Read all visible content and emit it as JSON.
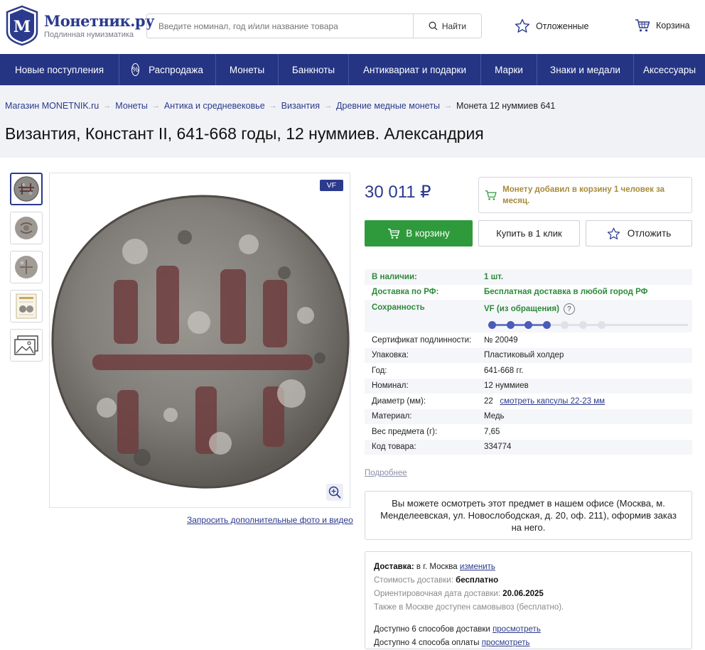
{
  "header": {
    "logo_title": "Монетник.ру",
    "logo_subtitle": "Подлинная нумизматика",
    "search_placeholder": "Введите номинал, год и/или название товара",
    "search_button": "Найти",
    "saved_label": "Отложенные",
    "cart_label": "Корзина"
  },
  "nav": {
    "items": [
      "Новые поступления",
      "Распродажа",
      "Монеты",
      "Банкноты",
      "Антиквариат и подарки",
      "Марки",
      "Знаки и медали",
      "Аксессуары"
    ],
    "sale_badge": "%"
  },
  "breadcrumb": {
    "items": [
      "Магазин MONETNIK.ru",
      "Монеты",
      "Антика и средневековье",
      "Византия",
      "Древние медные монеты"
    ],
    "current": "Монета 12 нуммиев 641",
    "separator": "→"
  },
  "product": {
    "title": "Византия, Констант II, 641-668 годы, 12 нуммиев. Александрия",
    "grade_badge": "VF",
    "price": "30 011 ₽",
    "cart_notice": "Монету добавил в корзину 1 человек за месяц.",
    "request_link": "Запросить дополнительные фото и видео",
    "buttons": {
      "add_to_cart": "В корзину",
      "buy_one_click": "Купить в 1 клик",
      "defer": "Отложить"
    },
    "availability": {
      "label": "В наличии:",
      "value": "1 шт."
    },
    "shipping": {
      "label": "Доставка по РФ:",
      "value": "Бесплатная доставка в любой город РФ"
    },
    "condition": {
      "label": "Сохранность",
      "value": "VF (из обращения)",
      "help": "?",
      "level": 4,
      "max": 7
    },
    "specs": [
      {
        "k": "Сертификат подлинности:",
        "v": "№ 20049"
      },
      {
        "k": "Упаковка:",
        "v": "Пластиковый холдер"
      },
      {
        "k": "Год:",
        "v": "641-668 гг."
      },
      {
        "k": "Номинал:",
        "v": "12 нуммиев"
      },
      {
        "k": "Диаметр (мм):",
        "v": "22",
        "link": "смотреть капсулы 22-23 мм"
      },
      {
        "k": "Материал:",
        "v": "Медь"
      },
      {
        "k": "Вес предмета (г):",
        "v": "7,65"
      },
      {
        "k": "Код товара:",
        "v": "334774"
      }
    ],
    "more_link": "Подробнее",
    "office_text": "Вы можете осмотреть этот предмет в нашем офисе (Москва, м. Менделеевская, ул. Новослободская, д. 20, оф. 211), оформив заказ на него."
  },
  "delivery": {
    "label": "Доставка:",
    "city": "в г. Москва",
    "change_link": "изменить",
    "cost_label": "Стоимость доставки:",
    "cost_value": "бесплатно",
    "date_label": "Ориентировочная дата доставки:",
    "date_value": "20.06.2025",
    "pickup_note": "Также в Москве доступен самовывоз (бесплатно).",
    "methods_text": "Доступно 6 способов доставки",
    "methods_link": "просмотреть",
    "payment_text": "Доступно 4 способа оплаты",
    "payment_link": "просмотреть"
  },
  "colors": {
    "brand": "#253584",
    "accent_green": "#2e9a3c",
    "notice_gold": "#a78b3a",
    "link": "#2b3a8c"
  }
}
